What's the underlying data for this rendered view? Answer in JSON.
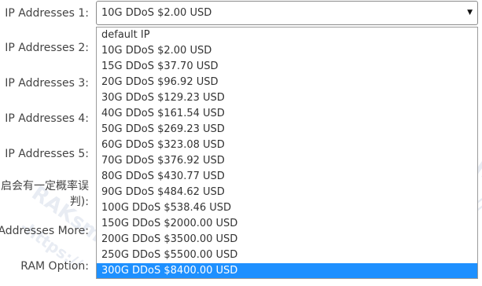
{
  "labels": {
    "ip1": "IP Addresses 1:",
    "ip2": "IP Addresses 2:",
    "ip3": "IP Addresses 3:",
    "ip4": "IP Addresses 4:",
    "ip5": "IP Addresses 5:",
    "notice": "启会有一定概率误判):",
    "more": "Addresses More:",
    "ram": "RAM Option:"
  },
  "select": {
    "value": "10G DDoS $2.00 USD",
    "arrow_icon": "triangle-down"
  },
  "options": [
    "default IP",
    "10G DDoS $2.00 USD",
    "15G DDoS $37.70 USD",
    "20G DDoS $96.92 USD",
    "30G DDoS $129.23 USD",
    "40G DDoS $161.54 USD",
    "50G DDoS $269.23 USD",
    "60G DDoS $323.08 USD",
    "70G DDoS $376.92 USD",
    "80G DDoS $430.77 USD",
    "90G DDoS $484.62 USD",
    "100G DDoS $538.46 USD",
    "150G DDoS $2000.00 USD",
    "200G DDoS $3500.00 USD",
    "250G DDoS $5500.00 USD",
    "300G DDoS $8400.00 USD"
  ],
  "highlighted_option_index": 15,
  "watermark": {
    "text1": "RAKsmart",
    "text2": "-https://"
  },
  "colors": {
    "highlight": "#1e90ff",
    "border": "#8a8a8a"
  }
}
